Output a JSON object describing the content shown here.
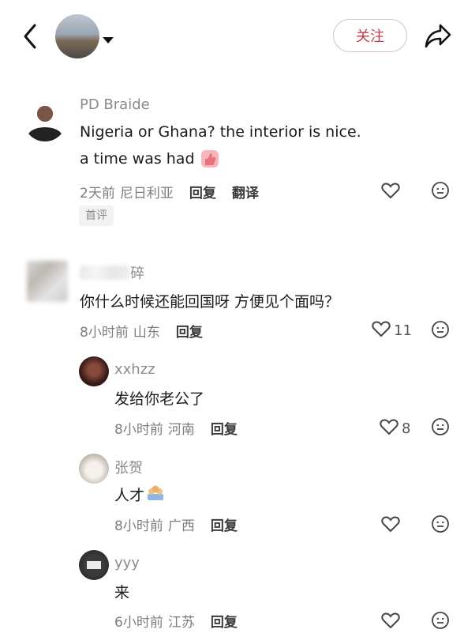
{
  "header": {
    "follow_label": "关注"
  },
  "comments": [
    {
      "name": "PD Braide",
      "lines": [
        "Nigeria or Ghana? the interior is nice.",
        "a time was had"
      ],
      "time": "2天前",
      "location": "尼日利亚",
      "reply_label": "回复",
      "translate_label": "翻译",
      "tag": "首评"
    },
    {
      "name_visible_suffix": "碎",
      "text": "你什么时候还能回国呀 方便见个面吗？",
      "time": "8小时前",
      "location": "山东",
      "reply_label": "回复",
      "likes": "11"
    },
    {
      "name": "xxhzz",
      "text": "发给你老公了",
      "time": "8小时前",
      "location": "河南",
      "reply_label": "回复",
      "likes": "8"
    },
    {
      "name": "张贺",
      "text": "人才",
      "time": "8小时前",
      "location": "广西",
      "reply_label": "回复"
    },
    {
      "name": "yyy",
      "text": "来",
      "time": "6小时前",
      "location": "江苏",
      "reply_label": "回复"
    }
  ]
}
